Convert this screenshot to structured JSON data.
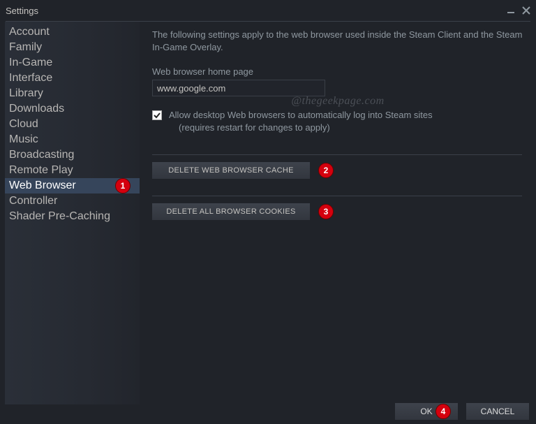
{
  "window": {
    "title": "Settings"
  },
  "sidebar": {
    "items": [
      {
        "label": "Account"
      },
      {
        "label": "Family"
      },
      {
        "label": "In-Game"
      },
      {
        "label": "Interface"
      },
      {
        "label": "Library"
      },
      {
        "label": "Downloads"
      },
      {
        "label": "Cloud"
      },
      {
        "label": "Music"
      },
      {
        "label": "Broadcasting"
      },
      {
        "label": "Remote Play"
      },
      {
        "label": "Web Browser"
      },
      {
        "label": "Controller"
      },
      {
        "label": "Shader Pre-Caching"
      }
    ],
    "selected_index": 10
  },
  "main": {
    "description": "The following settings apply to the web browser used inside the Steam Client and the Steam In-Game Overlay.",
    "home_page_label": "Web browser home page",
    "home_page_value": "www.google.com",
    "checkbox_label_line1": "Allow desktop Web browsers to automatically log into Steam sites",
    "checkbox_label_line2": "(requires restart for changes to apply)",
    "checkbox_checked": true,
    "delete_cache_label": "DELETE WEB BROWSER CACHE",
    "delete_cookies_label": "DELETE ALL BROWSER COOKIES"
  },
  "footer": {
    "ok_label": "OK",
    "cancel_label": "CANCEL"
  },
  "annotations": {
    "badge1": "1",
    "badge2": "2",
    "badge3": "3",
    "badge4": "4"
  },
  "watermark": "@thegeekpage.com"
}
